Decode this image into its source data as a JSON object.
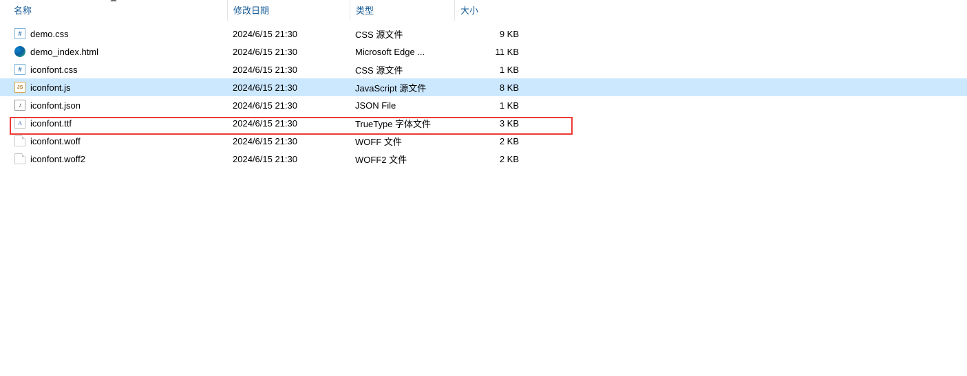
{
  "columns": {
    "name": "名称",
    "date": "修改日期",
    "type": "类型",
    "size": "大小"
  },
  "files": [
    {
      "name": "demo.css",
      "date": "2024/6/15 21:30",
      "type": "CSS 源文件",
      "size": "9 KB",
      "icon": "css-file-icon",
      "selected": false,
      "highlighted": false
    },
    {
      "name": "demo_index.html",
      "date": "2024/6/15 21:30",
      "type": "Microsoft Edge ...",
      "size": "11 KB",
      "icon": "edge-file-icon",
      "selected": false,
      "highlighted": false
    },
    {
      "name": "iconfont.css",
      "date": "2024/6/15 21:30",
      "type": "CSS 源文件",
      "size": "1 KB",
      "icon": "css-file-icon",
      "selected": false,
      "highlighted": false
    },
    {
      "name": "iconfont.js",
      "date": "2024/6/15 21:30",
      "type": "JavaScript 源文件",
      "size": "8 KB",
      "icon": "js-file-icon",
      "selected": true,
      "highlighted": false
    },
    {
      "name": "iconfont.json",
      "date": "2024/6/15 21:30",
      "type": "JSON File",
      "size": "1 KB",
      "icon": "json-file-icon",
      "selected": false,
      "highlighted": false
    },
    {
      "name": "iconfont.ttf",
      "date": "2024/6/15 21:30",
      "type": "TrueType 字体文件",
      "size": "3 KB",
      "icon": "ttf-file-icon",
      "selected": false,
      "highlighted": true
    },
    {
      "name": "iconfont.woff",
      "date": "2024/6/15 21:30",
      "type": "WOFF 文件",
      "size": "2 KB",
      "icon": "generic-file-icon",
      "selected": false,
      "highlighted": false
    },
    {
      "name": "iconfont.woff2",
      "date": "2024/6/15 21:30",
      "type": "WOFF2 文件",
      "size": "2 KB",
      "icon": "generic-file-icon",
      "selected": false,
      "highlighted": false
    }
  ]
}
